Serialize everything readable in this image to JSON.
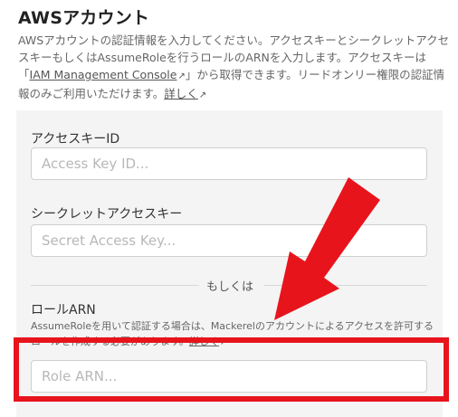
{
  "page": {
    "title": "AWSアカウント",
    "description": {
      "part1": "AWSアカウントの認証情報を入力してください。アクセスキーとシークレットアクセスキーもしくはAssumeRoleを行うロールのARNを入力します。アクセスキーは「",
      "console_link": "IAM Management Console",
      "part2": "」から取得できます。リードオンリー権限の認証情報のみご利用いただけます。",
      "details_link": "詳しく"
    }
  },
  "form": {
    "access_key": {
      "label": "アクセスキーID",
      "placeholder": "Access Key ID...",
      "value": ""
    },
    "secret_key": {
      "label": "シークレットアクセスキー",
      "placeholder": "Secret Access Key...",
      "value": ""
    },
    "separator": "もしくは",
    "role_arn": {
      "label": "ロールARN",
      "note": "AssumeRoleを用いて認証する場合は、Mackerelのアカウントによるアクセスを許可するロールを作成する必要があります。",
      "note_link": "詳しく",
      "placeholder": "Role ARN...",
      "value": ""
    }
  },
  "annotation": {
    "highlight_color": "#e8141c",
    "arrow_color": "#e8141c"
  },
  "icons": {
    "external_link": "external-link-icon"
  }
}
